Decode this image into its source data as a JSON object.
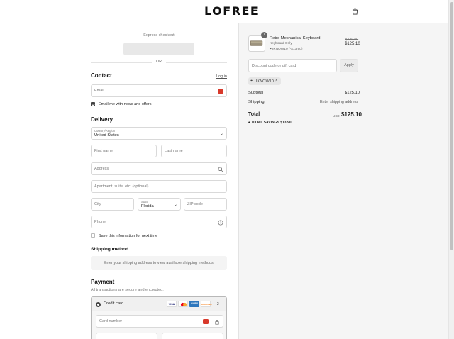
{
  "brand": "LOFREE",
  "express": {
    "title": "Express checkout",
    "or": "OR"
  },
  "contact": {
    "heading": "Contact",
    "login": "Log in",
    "email_placeholder": "Email",
    "news_label": "Email me with news and offers"
  },
  "delivery": {
    "heading": "Delivery",
    "country_label": "Country/Region",
    "country_value": "United States",
    "first_name": "First name",
    "last_name": "Last name",
    "address": "Address",
    "apartment": "Apartment, suite, etc. (optional)",
    "city": "City",
    "state_label": "State",
    "state_value": "Florida",
    "zip": "ZIP code",
    "phone": "Phone",
    "save_label": "Save this information for next time"
  },
  "shipping": {
    "heading": "Shipping method",
    "note": "Enter your shipping address to view available shipping methods."
  },
  "payment": {
    "heading": "Payment",
    "subtitle": "All transactions are secure and encrypted.",
    "method": "Credit card",
    "cards": [
      "VISA",
      "MC",
      "AMEX",
      "DISCOVER"
    ],
    "more": "+2",
    "card_number": "Card number"
  },
  "summary": {
    "quantity": "1",
    "product_name": "Retro Mechanical Keyboard",
    "variant": "Keyboard Only",
    "item_discount": "IKNOW10 (-$13.90)",
    "compare_price": "$139.00",
    "price": "$125.10",
    "discount_placeholder": "Discount code or gift card",
    "apply": "Apply",
    "code_chip": "IKNOW10",
    "subtotal_label": "Subtotal",
    "subtotal_value": "$125.10",
    "shipping_label": "Shipping",
    "shipping_value": "Enter shipping address",
    "total_label": "Total",
    "currency": "USD",
    "total_value": "$125.10",
    "savings_label": "TOTAL SAVINGS",
    "savings_value": "$13.90"
  },
  "colors": {
    "accent": "#444444",
    "panel": "#f5f5f5",
    "badge_red": "#d8392b"
  }
}
